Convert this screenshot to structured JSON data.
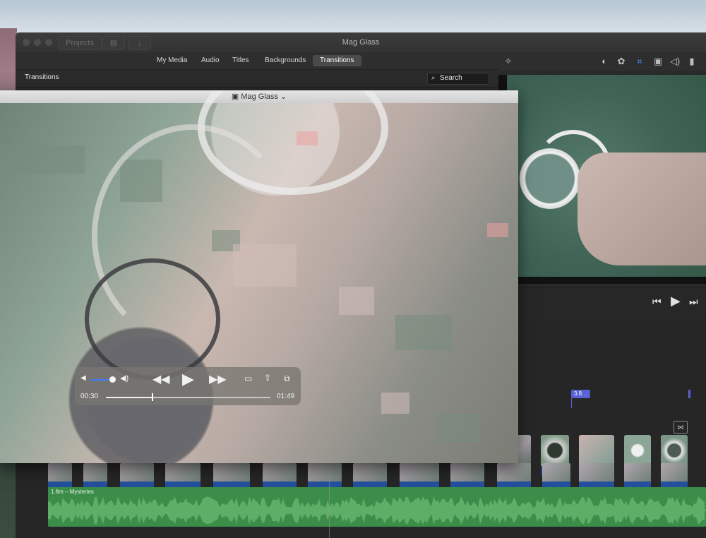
{
  "window": {
    "title": "Mag Glass",
    "projects_label": "Projects"
  },
  "browser_tabs": [
    "My Media",
    "Audio",
    "Titles",
    "Backgrounds",
    "Transitions"
  ],
  "active_tab": "Transitions",
  "section": {
    "title": "Transitions",
    "search_placeholder": "Search"
  },
  "toolbar_icons": [
    "magic-wand-icon",
    "color-balance-icon",
    "color-palette-icon",
    "crop-icon",
    "stabilization-camera-icon",
    "volume-icon",
    "equalizer-icon"
  ],
  "viewer": {
    "controls": [
      "skip-back-icon",
      "play-icon",
      "skip-forward-icon"
    ]
  },
  "timeline": {
    "clip_badge": "3.8…",
    "audio_clip_label": "1.8m – Mysteries"
  },
  "quicktime": {
    "title": "Mag Glass",
    "current_time": "00:30",
    "duration": "01:49",
    "volume_level": 0.9,
    "progress_fraction": 0.28
  },
  "colors": {
    "accent": "#3a7bf7",
    "audio_track": "#3d8d4a",
    "video_bar": "#1e3f7a",
    "badge": "#5661d6"
  }
}
